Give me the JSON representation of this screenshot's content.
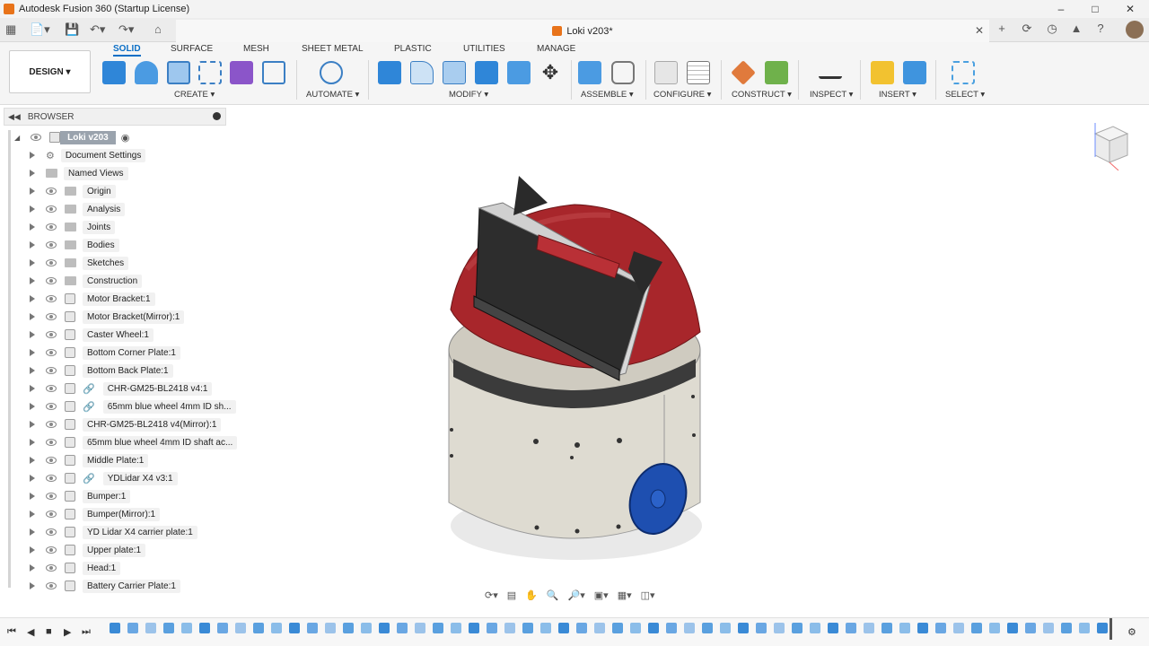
{
  "app": {
    "window_title": "Autodesk Fusion 360 (Startup License)",
    "document_tab": "Loki v203*"
  },
  "ribbon": {
    "tabs": [
      "SOLID",
      "SURFACE",
      "MESH",
      "SHEET METAL",
      "PLASTIC",
      "UTILITIES",
      "MANAGE"
    ],
    "active_tab": "SOLID",
    "workspace": "DESIGN ▾",
    "groups": [
      "CREATE ▾",
      "AUTOMATE ▾",
      "MODIFY ▾",
      "ASSEMBLE ▾",
      "CONFIGURE ▾",
      "CONSTRUCT ▾",
      "INSPECT ▾",
      "INSERT ▾",
      "SELECT ▾"
    ]
  },
  "browser": {
    "title": "BROWSER",
    "root": "Loki v203",
    "items": [
      {
        "label": "Document Settings",
        "icon": "gear-icon"
      },
      {
        "label": "Named Views",
        "icon": "folder-icon"
      },
      {
        "label": "Origin",
        "icon": "folder-icon"
      },
      {
        "label": "Analysis",
        "icon": "folder-icon"
      },
      {
        "label": "Joints",
        "icon": "folder-icon"
      },
      {
        "label": "Bodies",
        "icon": "folder-icon"
      },
      {
        "label": "Sketches",
        "icon": "folder-icon"
      },
      {
        "label": "Construction",
        "icon": "folder-icon"
      },
      {
        "label": "Motor Bracket:1",
        "icon": "component-icon"
      },
      {
        "label": "Motor Bracket(Mirror):1",
        "icon": "component-icon"
      },
      {
        "label": "Caster Wheel:1",
        "icon": "component-icon"
      },
      {
        "label": "Bottom Corner Plate:1",
        "icon": "component-icon"
      },
      {
        "label": "Bottom Back Plate:1",
        "icon": "component-icon"
      },
      {
        "label": "CHR-GM25-BL2418 v4:1",
        "icon": "component-icon"
      },
      {
        "label": "65mm blue wheel 4mm ID sh...",
        "icon": "component-icon"
      },
      {
        "label": "CHR-GM25-BL2418 v4(Mirror):1",
        "icon": "component-icon"
      },
      {
        "label": "65mm blue wheel 4mm ID shaft ac...",
        "icon": "component-icon"
      },
      {
        "label": "Middle Plate:1",
        "icon": "component-icon"
      },
      {
        "label": "YDLidar X4 v3:1",
        "icon": "component-icon"
      },
      {
        "label": "Bumper:1",
        "icon": "component-icon"
      },
      {
        "label": "Bumper(Mirror):1",
        "icon": "component-icon"
      },
      {
        "label": "YD Lidar X4 carrier plate:1",
        "icon": "component-icon"
      },
      {
        "label": "Upper plate:1",
        "icon": "component-icon"
      },
      {
        "label": "Head:1",
        "icon": "component-icon"
      },
      {
        "label": "Battery Carrier Plate:1",
        "icon": "component-icon"
      }
    ]
  },
  "colors": {
    "accent": "#0b6fc6",
    "head_red": "#a8262b",
    "body_grey": "#dedbd1",
    "wheel_blue": "#1e4fb0"
  }
}
